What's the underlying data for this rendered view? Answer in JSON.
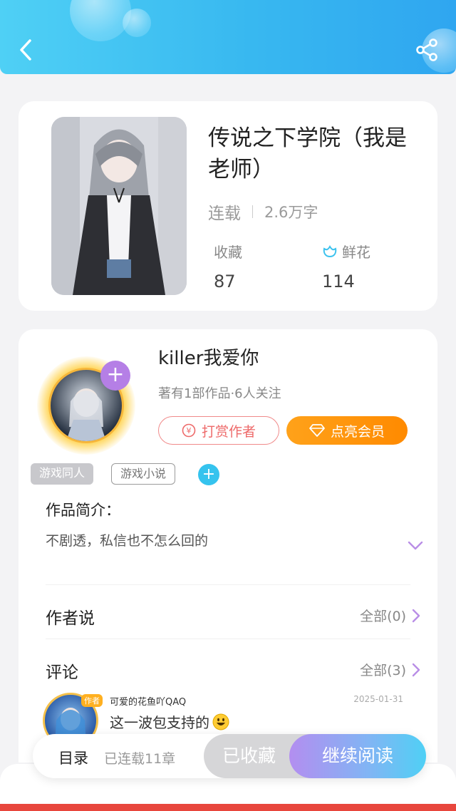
{
  "colors": {
    "header_start": "#4fd0f5",
    "header_end": "#2fa6f0",
    "accent_purple": "#b57fe6",
    "vip_orange": "#ff8a00",
    "reward_red": "#ee6a6a"
  },
  "header": {
    "back_icon": "chevron-left-icon",
    "share_icon": "share-icon"
  },
  "book": {
    "title": "传说之下学院（我是老师）",
    "status": "连载",
    "word_count": "2.6万字",
    "favorites_label": "收藏",
    "favorites_value": "87",
    "flowers_label": "鲜花",
    "flowers_value": "114"
  },
  "author": {
    "name": "killer我爱你",
    "meta": "著有1部作品·6人关注",
    "reward_label": "打赏作者",
    "vip_label": "点亮会员"
  },
  "tags": [
    "游戏同人",
    "游戏小说"
  ],
  "intro": {
    "title": "作品简介：",
    "text": "不剧透，私信也不怎么回的"
  },
  "author_says": {
    "title": "作者说",
    "more": "全部(0)"
  },
  "comments": {
    "title": "评论",
    "more": "全部(3)",
    "first": {
      "user": "可爱的花鱼吖QAQ",
      "badge": "作者",
      "date": "2025-01-31",
      "text": "这一波包支持的"
    }
  },
  "bottom_bar": {
    "toc_label": "目录",
    "chapter_count": "已连载11章",
    "collected_label": "已收藏",
    "read_label": "继续阅读"
  }
}
